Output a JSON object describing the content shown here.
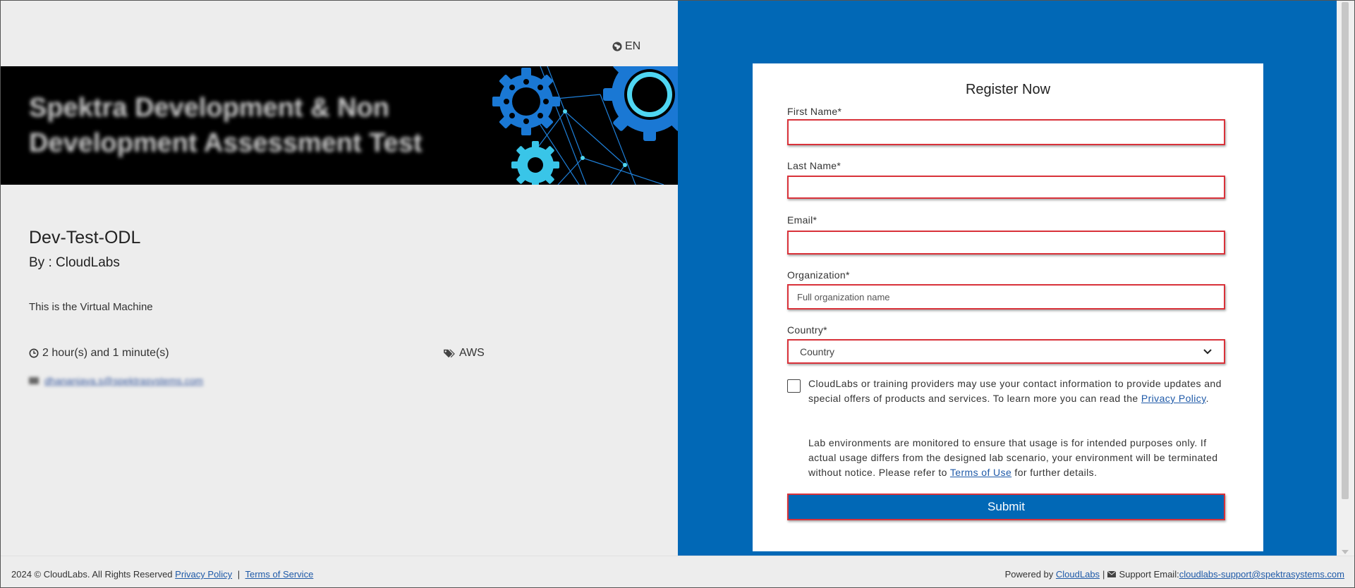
{
  "header": {
    "language": "EN"
  },
  "banner": {
    "title": "Spektra Development & Non Development Assessment Test"
  },
  "course": {
    "title": "Dev-Test-ODL",
    "by": "By : CloudLabs",
    "description": "This is the Virtual Machine",
    "duration": "2 hour(s) and 1 minute(s)",
    "tag": "AWS",
    "contact_email": "dhananjaya.s@spektrasystems.com"
  },
  "form": {
    "title": "Register Now",
    "first_name_label": "First Name*",
    "last_name_label": "Last Name*",
    "email_label": "Email*",
    "organization_label": "Organization*",
    "organization_placeholder": "Full organization name",
    "country_label": "Country*",
    "country_selected": "Country",
    "consent_text": "CloudLabs or training providers may use your contact information to provide updates and special offers of products and services. To learn more you can read the ",
    "privacy_link": "Privacy Policy",
    "notice_text": "Lab environments are monitored to ensure that usage is for intended purposes only. If actual usage differs from the designed lab scenario, your environment will be terminated without notice. Please refer to ",
    "terms_link": "Terms of Use",
    "notice_suffix": " for further details.",
    "submit_label": "Submit"
  },
  "footer": {
    "copyright": "2024 © CloudLabs. All Rights Reserved",
    "privacy_link": "Privacy Policy",
    "separator": "|",
    "terms_link": "Terms of Service",
    "powered_by": "Powered by",
    "cloudlabs_link": "CloudLabs",
    "support_label": "Support Email:",
    "support_email": "cloudlabs-support@spektrasystems.com"
  },
  "colors": {
    "brand_blue": "#0168b6",
    "error_red": "#d9323a",
    "page_gray": "#ededed"
  },
  "icons": {
    "language": "globe-icon",
    "duration": "clock-icon",
    "tag": "tags-icon",
    "contact": "envelope-icon",
    "country": "chevron-down-icon"
  }
}
